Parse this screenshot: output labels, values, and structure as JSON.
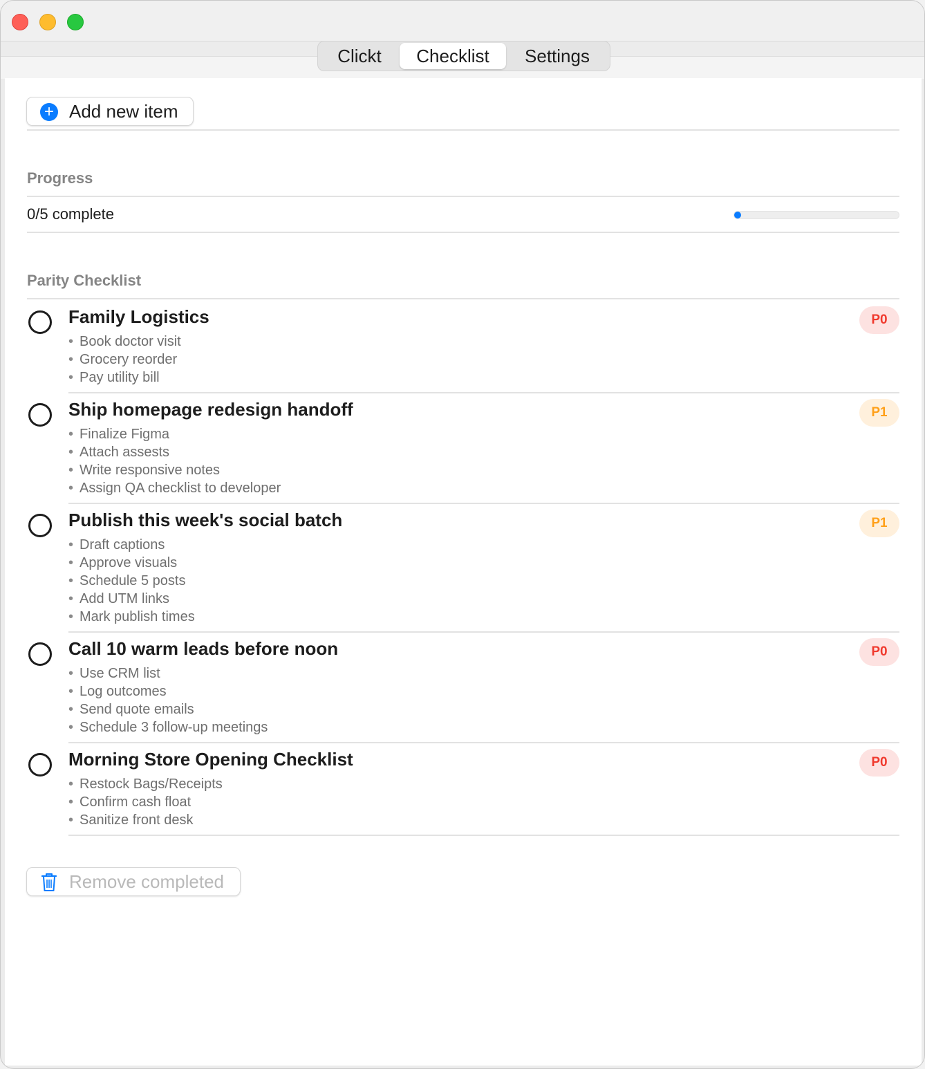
{
  "window": {
    "controls": {
      "close_color": "#fe5f57",
      "minimize_color": "#febc2e",
      "maximize_color": "#28c840"
    }
  },
  "tabs": [
    {
      "label": "Clickt",
      "selected": false
    },
    {
      "label": "Checklist",
      "selected": true
    },
    {
      "label": "Settings",
      "selected": false
    }
  ],
  "toolbar": {
    "add_label": "Add new item",
    "add_icon": "plus-circle-icon"
  },
  "progress": {
    "section_label": "Progress",
    "status_text": "0/5 complete",
    "completed": 0,
    "total": 5,
    "fraction": 0
  },
  "checklist": {
    "section_label": "Parity Checklist",
    "items": [
      {
        "title": "Family Logistics",
        "priority": "P0",
        "done": false,
        "subtasks": [
          "Book doctor visit",
          "Grocery reorder",
          "Pay utility bill"
        ]
      },
      {
        "title": "Ship homepage redesign handoff",
        "priority": "P1",
        "done": false,
        "subtasks": [
          "Finalize Figma",
          "Attach assests",
          "Write responsive notes",
          "Assign QA checklist to developer"
        ]
      },
      {
        "title": "Publish this week's social batch",
        "priority": "P1",
        "done": false,
        "subtasks": [
          "Draft captions",
          "Approve visuals",
          "Schedule 5 posts",
          "Add UTM links",
          "Mark publish times"
        ]
      },
      {
        "title": "Call 10 warm leads before noon",
        "priority": "P0",
        "done": false,
        "subtasks": [
          "Use CRM list",
          "Log outcomes",
          "Send quote emails",
          "Schedule 3 follow-up meetings"
        ]
      },
      {
        "title": "Morning Store Opening Checklist",
        "priority": "P0",
        "done": false,
        "subtasks": [
          "Restock Bags/Receipts",
          "Confirm cash float",
          "Sanitize front desk"
        ]
      }
    ]
  },
  "footer": {
    "remove_label": "Remove completed",
    "remove_icon": "trash-icon",
    "remove_enabled": false
  },
  "colors": {
    "accent": "#0a7cff",
    "p0_text": "#f03a2e",
    "p0_bg": "#fde2e1",
    "p1_text": "#ffa019",
    "p1_bg": "#fff0dc"
  }
}
